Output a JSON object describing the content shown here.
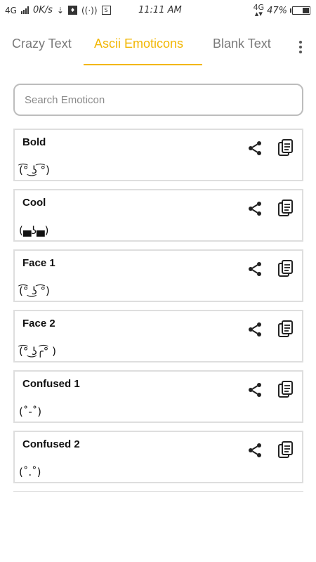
{
  "status_bar": {
    "network": "4G",
    "speed": "0K/s",
    "time": "11:11 AM",
    "network_right": "4G",
    "battery_percent": "47%",
    "battery_level": 0.47
  },
  "tabs": [
    {
      "label": "Crazy Text",
      "active": false
    },
    {
      "label": "Ascii Emoticons",
      "active": true
    },
    {
      "label": "Blank Text",
      "active": false
    }
  ],
  "search": {
    "placeholder": "Search Emoticon",
    "value": ""
  },
  "emoticons": [
    {
      "name": "Bold",
      "text": "(͡° ͜ʖ ͡°)"
    },
    {
      "name": "Cool",
      "text": "(▄ʖ▄)"
    },
    {
      "name": "Face 1",
      "text": "(͡° ͜ʖ ͡°)"
    },
    {
      "name": "Face 2",
      "text": "(͡° ͜ʖ╭͡° )"
    },
    {
      "name": "Confused 1",
      "text": "(˚-˚)"
    },
    {
      "name": "Confused 2",
      "text": "(˚.˚)"
    }
  ],
  "colors": {
    "accent": "#f2b705",
    "tab_inactive": "#7a7a7a",
    "card_border": "#dedede"
  },
  "icons": {
    "share": "share-icon",
    "copy": "copy-icon",
    "menu": "more-vertical-icon"
  }
}
